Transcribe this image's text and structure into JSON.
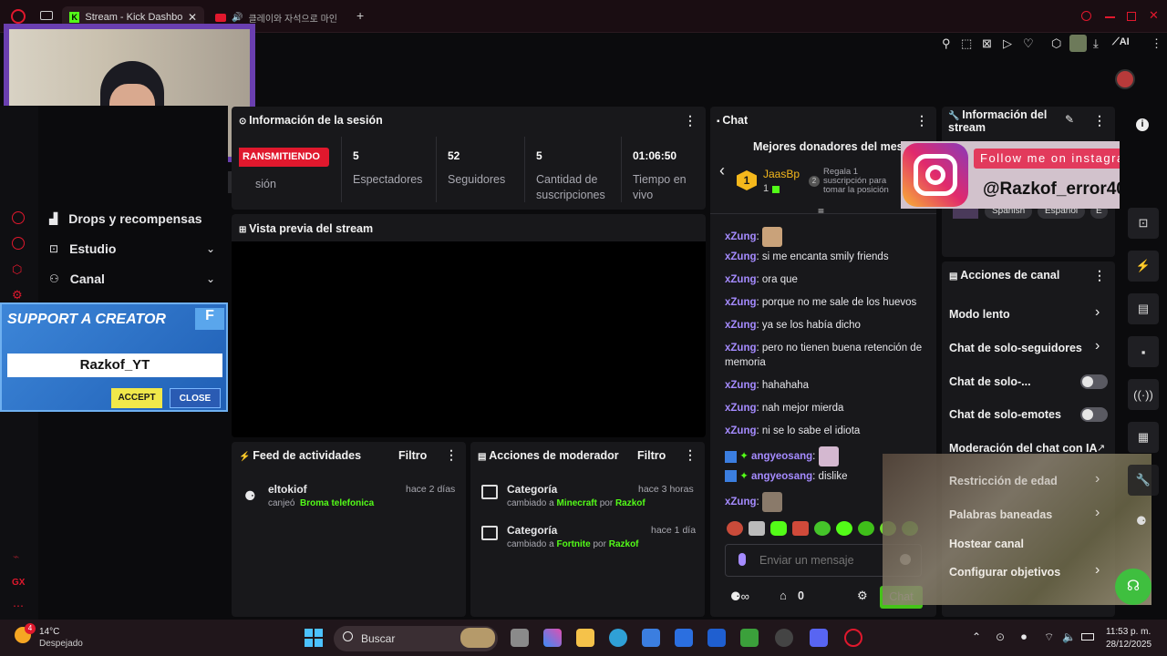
{
  "browser": {
    "tabs": [
      {
        "label": "Stream - Kick Dashboa",
        "active": true
      },
      {
        "label": "클레이와 자석으로 마인",
        "active": false
      }
    ],
    "new_tab": "+"
  },
  "toolbar": {
    "ai_label": "AI"
  },
  "session": {
    "title": "Información de la sesión",
    "status_badge": "RANSMITIENDO",
    "status_label": "sión",
    "stats": [
      {
        "value": "5",
        "label": "Espectadores"
      },
      {
        "value": "52",
        "label": "Seguidores"
      },
      {
        "value": "5",
        "label": "Cantidad de suscripciones"
      },
      {
        "value": "01:06:50",
        "label": "Tiempo en vivo"
      }
    ]
  },
  "preview": {
    "title": "Vista previa del stream"
  },
  "sidebar": {
    "items": [
      {
        "label": "Drops y recompensas"
      },
      {
        "label": "Estudio"
      },
      {
        "label": "Canal"
      }
    ]
  },
  "support_overlay": {
    "title": "SUPPORT A CREATOR",
    "name": "Razkof_YT",
    "accept": "ACCEPT",
    "close": "CLOSE"
  },
  "activity_feed": {
    "title": "Feed de actividades",
    "filter": "Filtro",
    "items": [
      {
        "user": "eltokiof",
        "time": "hace 2 días",
        "text": "canjeó",
        "reward": "Broma telefonica"
      }
    ]
  },
  "mod_actions": {
    "title": "Acciones de moderador",
    "filter": "Filtro",
    "items": [
      {
        "title": "Categoría",
        "time": "hace 3 horas",
        "prefix": "cambiado a",
        "category": "Minecraft",
        "by": "por",
        "user": "Razkof"
      },
      {
        "title": "Categoría",
        "time": "hace 1 día",
        "prefix": "cambiado a",
        "category": "Fortnite",
        "by": "por",
        "user": "Razkof"
      }
    ]
  },
  "chat": {
    "title": "Chat",
    "top_donors": "Mejores donadores del mes",
    "donor": {
      "name": "JaasBp",
      "rank": "1",
      "count": "1",
      "note": "Regala 1 suscripción para tomar la posición"
    },
    "messages": [
      {
        "user": "xZung",
        "text": ""
      },
      {
        "user": "xZung",
        "text": "si me encanta smily friends"
      },
      {
        "user": "xZung",
        "text": "ora que"
      },
      {
        "user": "xZung",
        "text": "porque no me sale de los huevos"
      },
      {
        "user": "xZung",
        "text": "ya se los había dicho"
      },
      {
        "user": "xZung",
        "text": "pero no tienen buena retención de memoria"
      },
      {
        "user": "xZung",
        "text": "hahahaha"
      },
      {
        "user": "xZung",
        "text": "nah mejor mierda"
      },
      {
        "user": "xZung",
        "text": "ni se lo sabe el idiota"
      },
      {
        "user": "angyeosang",
        "text": ""
      },
      {
        "user": "angyeosang",
        "text": "dislike"
      },
      {
        "user": "xZung",
        "text": ""
      }
    ],
    "input_placeholder": "Enviar un mensaje",
    "points": "0",
    "send_label": "Chat"
  },
  "stream_info": {
    "title": "Información del stream",
    "tags": [
      "Spanish",
      "Español",
      "E"
    ]
  },
  "instagram_overlay": {
    "line1": "Follow me on instagram",
    "handle": "@Razkof_error404"
  },
  "channel_actions": {
    "title": "Acciones de canal",
    "items": [
      {
        "label": "Modo lento"
      },
      {
        "label": "Chat de solo-seguidores"
      },
      {
        "label": "Chat de solo-..."
      },
      {
        "label": "Chat de solo-emotes"
      },
      {
        "label": "Moderación del chat con IA"
      },
      {
        "label": "Restricción de edad"
      },
      {
        "label": "Palabras baneadas"
      },
      {
        "label": "Hostear canal"
      },
      {
        "label": "Configurar objetivos"
      }
    ]
  },
  "taskbar": {
    "weather_temp": "14°C",
    "weather_desc": "Despejado",
    "weather_badge": "4",
    "search": "Buscar",
    "time": "11:53 p. m.",
    "date": "28/12/2025"
  },
  "colors": {
    "kick_green": "#53fc18",
    "accent_purple": "#a58bff",
    "live_red": "#e0182d"
  }
}
